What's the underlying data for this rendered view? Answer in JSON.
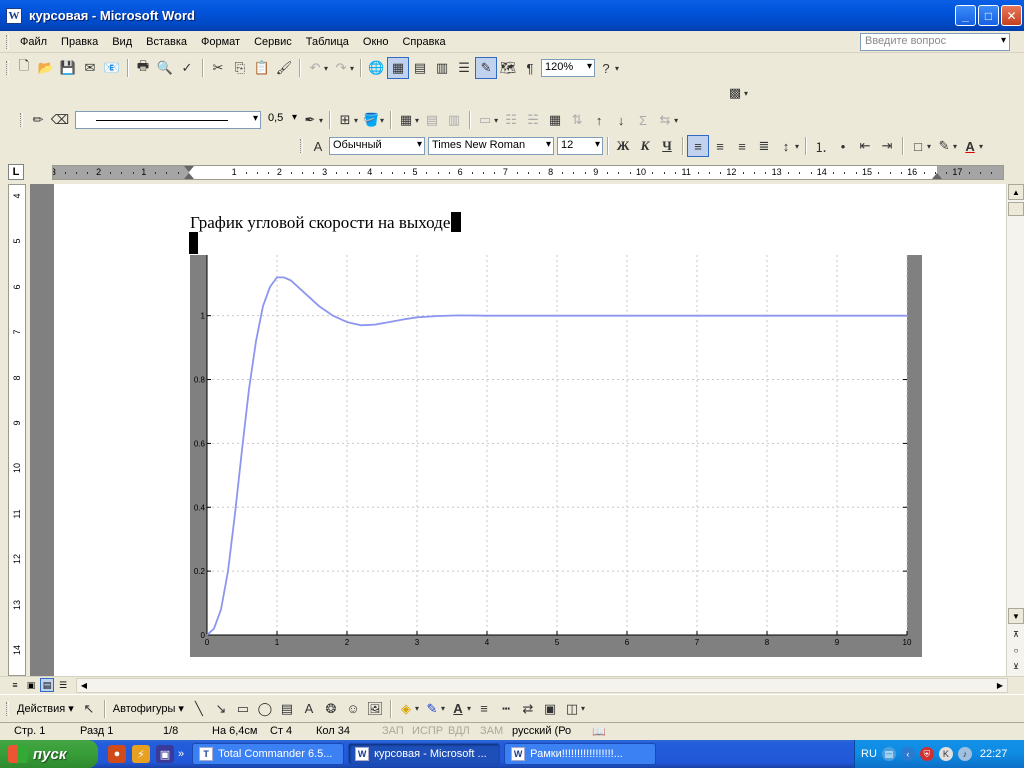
{
  "window": {
    "title": "курсовая - Microsoft Word",
    "app_icon": "word-icon",
    "controls": {
      "minimize": "_",
      "maximize": "□",
      "close": "✕"
    }
  },
  "menu": {
    "items": [
      "Файл",
      "Правка",
      "Вид",
      "Вставка",
      "Формат",
      "Сервис",
      "Таблица",
      "Окно",
      "Справка"
    ],
    "help_placeholder": "Введите вопрос"
  },
  "standard_toolbar": {
    "zoom": "120%"
  },
  "drawing_format_toolbar": {
    "line_width": "0,5"
  },
  "formatting_toolbar": {
    "style": "Обычный",
    "font": "Times New Roman",
    "size": "12",
    "bold": "Ж",
    "italic": "К",
    "underline": "Ч"
  },
  "ruler": {
    "horizontal": [
      "3",
      "2",
      "1",
      "1",
      "2",
      "3",
      "4",
      "5",
      "6",
      "7",
      "8",
      "9",
      "10",
      "11",
      "12",
      "13",
      "14",
      "15",
      "16",
      "17"
    ],
    "vertical": [
      "4",
      "5",
      "6",
      "7",
      "8",
      "9",
      "10",
      "11",
      "12",
      "13",
      "14"
    ],
    "corner": "L"
  },
  "document": {
    "heading": "График угловой скорости на выходе"
  },
  "chart_data": {
    "type": "line",
    "title": "",
    "xlabel": "",
    "ylabel": "",
    "xlim": [
      0,
      10
    ],
    "ylim": [
      0,
      1.1
    ],
    "xticks": [
      "0",
      "1",
      "2",
      "3",
      "4",
      "5",
      "6",
      "7",
      "8",
      "9",
      "10"
    ],
    "yticks": [
      "0",
      "0.2",
      "0.4",
      "0.6",
      "0.8",
      "1"
    ],
    "ytick_values": [
      0,
      0.2,
      0.4,
      0.6,
      0.8,
      1
    ],
    "grid": true,
    "line_color": "#8C95F0",
    "series": [
      {
        "x": [
          0,
          0.1,
          0.2,
          0.3,
          0.4,
          0.5,
          0.6,
          0.7,
          0.8,
          0.9,
          1.0,
          1.1,
          1.2,
          1.3,
          1.4,
          1.5,
          1.6,
          1.8,
          2.0,
          2.2,
          2.4,
          2.6,
          2.8,
          3.0,
          3.3,
          3.6,
          4.0,
          5,
          6,
          7,
          8,
          9,
          10
        ],
        "y": [
          0,
          0.02,
          0.08,
          0.2,
          0.38,
          0.58,
          0.77,
          0.92,
          1.03,
          1.09,
          1.12,
          1.12,
          1.11,
          1.09,
          1.07,
          1.05,
          1.03,
          1.0,
          0.98,
          0.97,
          0.972,
          0.98,
          0.988,
          0.995,
          0.999,
          1.001,
          1.0,
          1.0,
          1.0,
          1.0,
          1.0,
          1.0,
          1.0
        ]
      }
    ]
  },
  "drawing_toolbar": {
    "actions": "Действия",
    "autoshapes": "Автофигуры"
  },
  "status": {
    "page": "Стр. 1",
    "section": "Разд 1",
    "pages": "1/8",
    "at": "На 6,4см",
    "line": "Ст 4",
    "col": "Кол 34",
    "rec": "ЗАП",
    "trk": "ИСПР",
    "ext": "ВДЛ",
    "ovr": "ЗАМ",
    "lang": "русский (Ро"
  },
  "taskbar": {
    "start": "пуск",
    "more": "»",
    "tasks": [
      {
        "label": "Total Commander 6.5...",
        "active": false
      },
      {
        "label": "курсовая - Microsoft ...",
        "active": true
      },
      {
        "label": "Рамки!!!!!!!!!!!!!!!!!...",
        "active": false
      }
    ],
    "lang": "RU",
    "clock": "22:27"
  }
}
